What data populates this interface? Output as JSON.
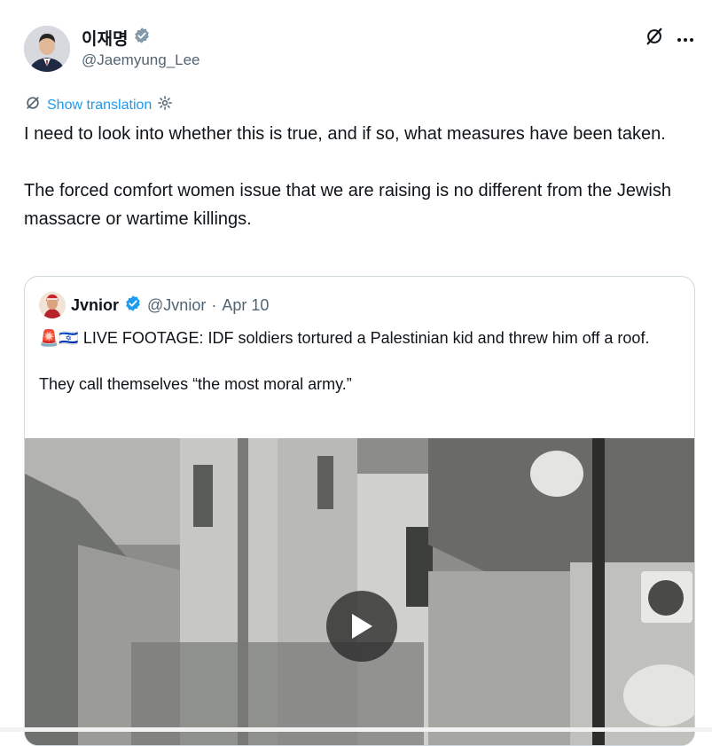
{
  "author": {
    "display_name": "이재명",
    "handle": "@Jaemyung_Lee"
  },
  "translation": {
    "label": "Show translation"
  },
  "tweet": {
    "paragraphs": [
      "I need to look into whether this is true, and if so, what measures have been taken.",
      "The forced comfort women issue that we are raising is no different from the Jewish massacre or wartime killings."
    ]
  },
  "quoted": {
    "display_name": "Jvnior",
    "handle": "@Jvnior",
    "separator": "·",
    "date": "Apr 10",
    "emoji_prefix": "🚨🇮🇱",
    "paragraphs": [
      "LIVE FOOTAGE: IDF soldiers tortured a Palestinian kid and threw him off a roof.",
      "They call themselves “the most moral army.”"
    ]
  },
  "colors": {
    "accent": "#1d9bf0",
    "muted": "#536471",
    "text": "#0f1419",
    "verified_gray": "#829aab",
    "border": "#cfd9de"
  },
  "icons": {
    "verified_gray": "verified-badge-icon",
    "verified_blue": "verified-blue-icon",
    "grok": "grok-icon",
    "more": "more-icon",
    "translate": "translate-icon",
    "settings": "settings-icon",
    "play": "play-icon"
  }
}
